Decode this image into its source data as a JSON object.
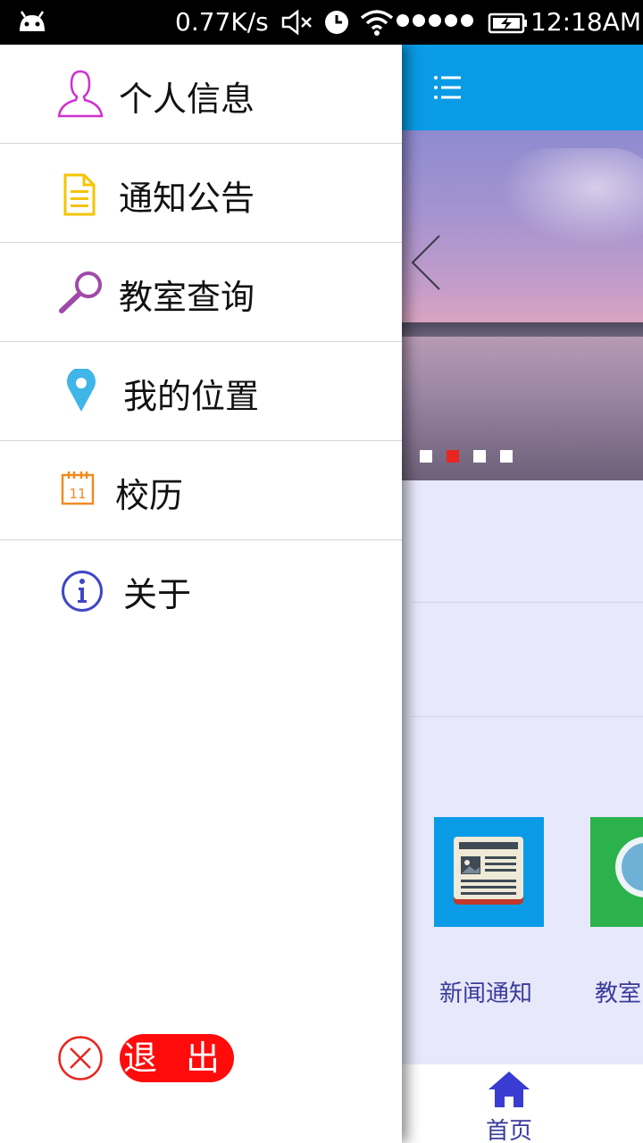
{
  "status_bar": {
    "net_speed": "0.77K/s",
    "time": "12:18AM",
    "icons": [
      "android-icon",
      "mute-icon",
      "alarm-icon",
      "wifi-icon",
      "signal-dots-icon",
      "battery-charging-icon"
    ]
  },
  "drawer": {
    "items": [
      {
        "label": "个人信息",
        "icon": "person-icon",
        "color": "#d02fd0"
      },
      {
        "label": "通知公告",
        "icon": "document-icon",
        "color": "#f5c400"
      },
      {
        "label": "教室查询",
        "icon": "magnifier-icon",
        "color": "#a04aa8"
      },
      {
        "label": "我的位置",
        "icon": "location-pin-icon",
        "color": "#3fb5e8"
      },
      {
        "label": "校历",
        "icon": "calendar-icon",
        "calendar_day": "11",
        "color": "#f08a24"
      },
      {
        "label": "关于",
        "icon": "info-icon",
        "color": "#3f47c6"
      }
    ],
    "logout_label": "退出",
    "logout_color": "#ff0b0b"
  },
  "main": {
    "appbar_color": "#0a9be6",
    "banner": {
      "slide_count": 4,
      "active_index": 1
    },
    "tiles": [
      {
        "label": "新闻通知",
        "icon": "newspaper-icon",
        "color": "#0a9be6"
      },
      {
        "label": "教室",
        "icon": "magnifier-icon",
        "color": "#2bb24c"
      }
    ],
    "bottom_nav": {
      "home_label": "首页",
      "color": "#3a3bd0"
    }
  }
}
